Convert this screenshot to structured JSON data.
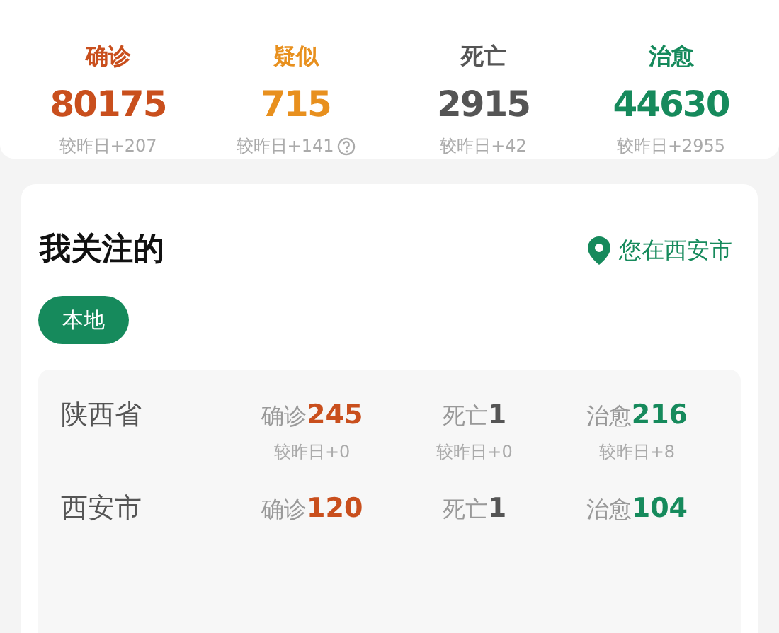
{
  "summary": [
    {
      "label": "确诊",
      "value": "80175",
      "delta": "较昨日+207",
      "color": "#c94f1d",
      "help": false
    },
    {
      "label": "疑似",
      "value": "715",
      "delta": "较昨日+141",
      "color": "#e8901e",
      "help": true
    },
    {
      "label": "死亡",
      "value": "2915",
      "delta": "较昨日+42",
      "color": "#555555",
      "help": false
    },
    {
      "label": "治愈",
      "value": "44630",
      "delta": "较昨日+2955",
      "color": "#168a5c",
      "help": false
    }
  ],
  "follow": {
    "title": "我关注的",
    "location": "您在西安市",
    "tabs": [
      {
        "label": "本地",
        "selected": true
      }
    ],
    "regions": [
      {
        "name": "陕西省",
        "stats": [
          {
            "label": "确诊",
            "value": "245",
            "delta": "较昨日+0",
            "color": "#c94f1d"
          },
          {
            "label": "死亡",
            "value": "1",
            "delta": "较昨日+0",
            "color": "#555555"
          },
          {
            "label": "治愈",
            "value": "216",
            "delta": "较昨日+8",
            "color": "#168a5c"
          }
        ]
      },
      {
        "name": "西安市",
        "stats": [
          {
            "label": "确诊",
            "value": "120",
            "color": "#c94f1d"
          },
          {
            "label": "死亡",
            "value": "1",
            "color": "#555555"
          },
          {
            "label": "治愈",
            "value": "104",
            "color": "#168a5c"
          }
        ]
      }
    ]
  }
}
